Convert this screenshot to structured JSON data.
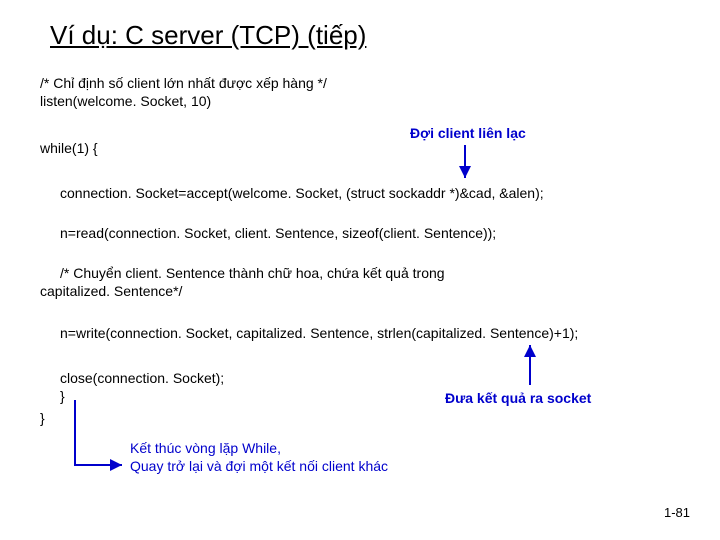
{
  "title": "Ví dụ: C server (TCP) (tiếp)",
  "code": {
    "l1": "/* Chỉ định số client lớn nhất được xếp hàng */",
    "l2": "listen(welcome. Socket, 10)",
    "l3": "while(1) {",
    "l4": "connection. Socket=accept(welcome. Socket, (struct sockaddr *)&cad, &alen);",
    "l5": "n=read(connection. Socket, client. Sentence, sizeof(client. Sentence));",
    "l6": "/* Chuyển client. Sentence thành chữ hoa, chứa kết quả trong",
    "l7": "capitalized. Sentence*/",
    "l8": "n=write(connection. Socket, capitalized. Sentence, strlen(capitalized. Sentence)+1);",
    "l9": "close(connection. Socket);",
    "l10": "}",
    "l11": "}"
  },
  "labels": {
    "wait": "Đợi client liên lạc",
    "out": "Đưa kết quả ra socket",
    "loop1": "Kết thúc vòng lặp While,",
    "loop2": "Quay trở lại và đợi một kết nối client khác"
  },
  "page": "1-81"
}
